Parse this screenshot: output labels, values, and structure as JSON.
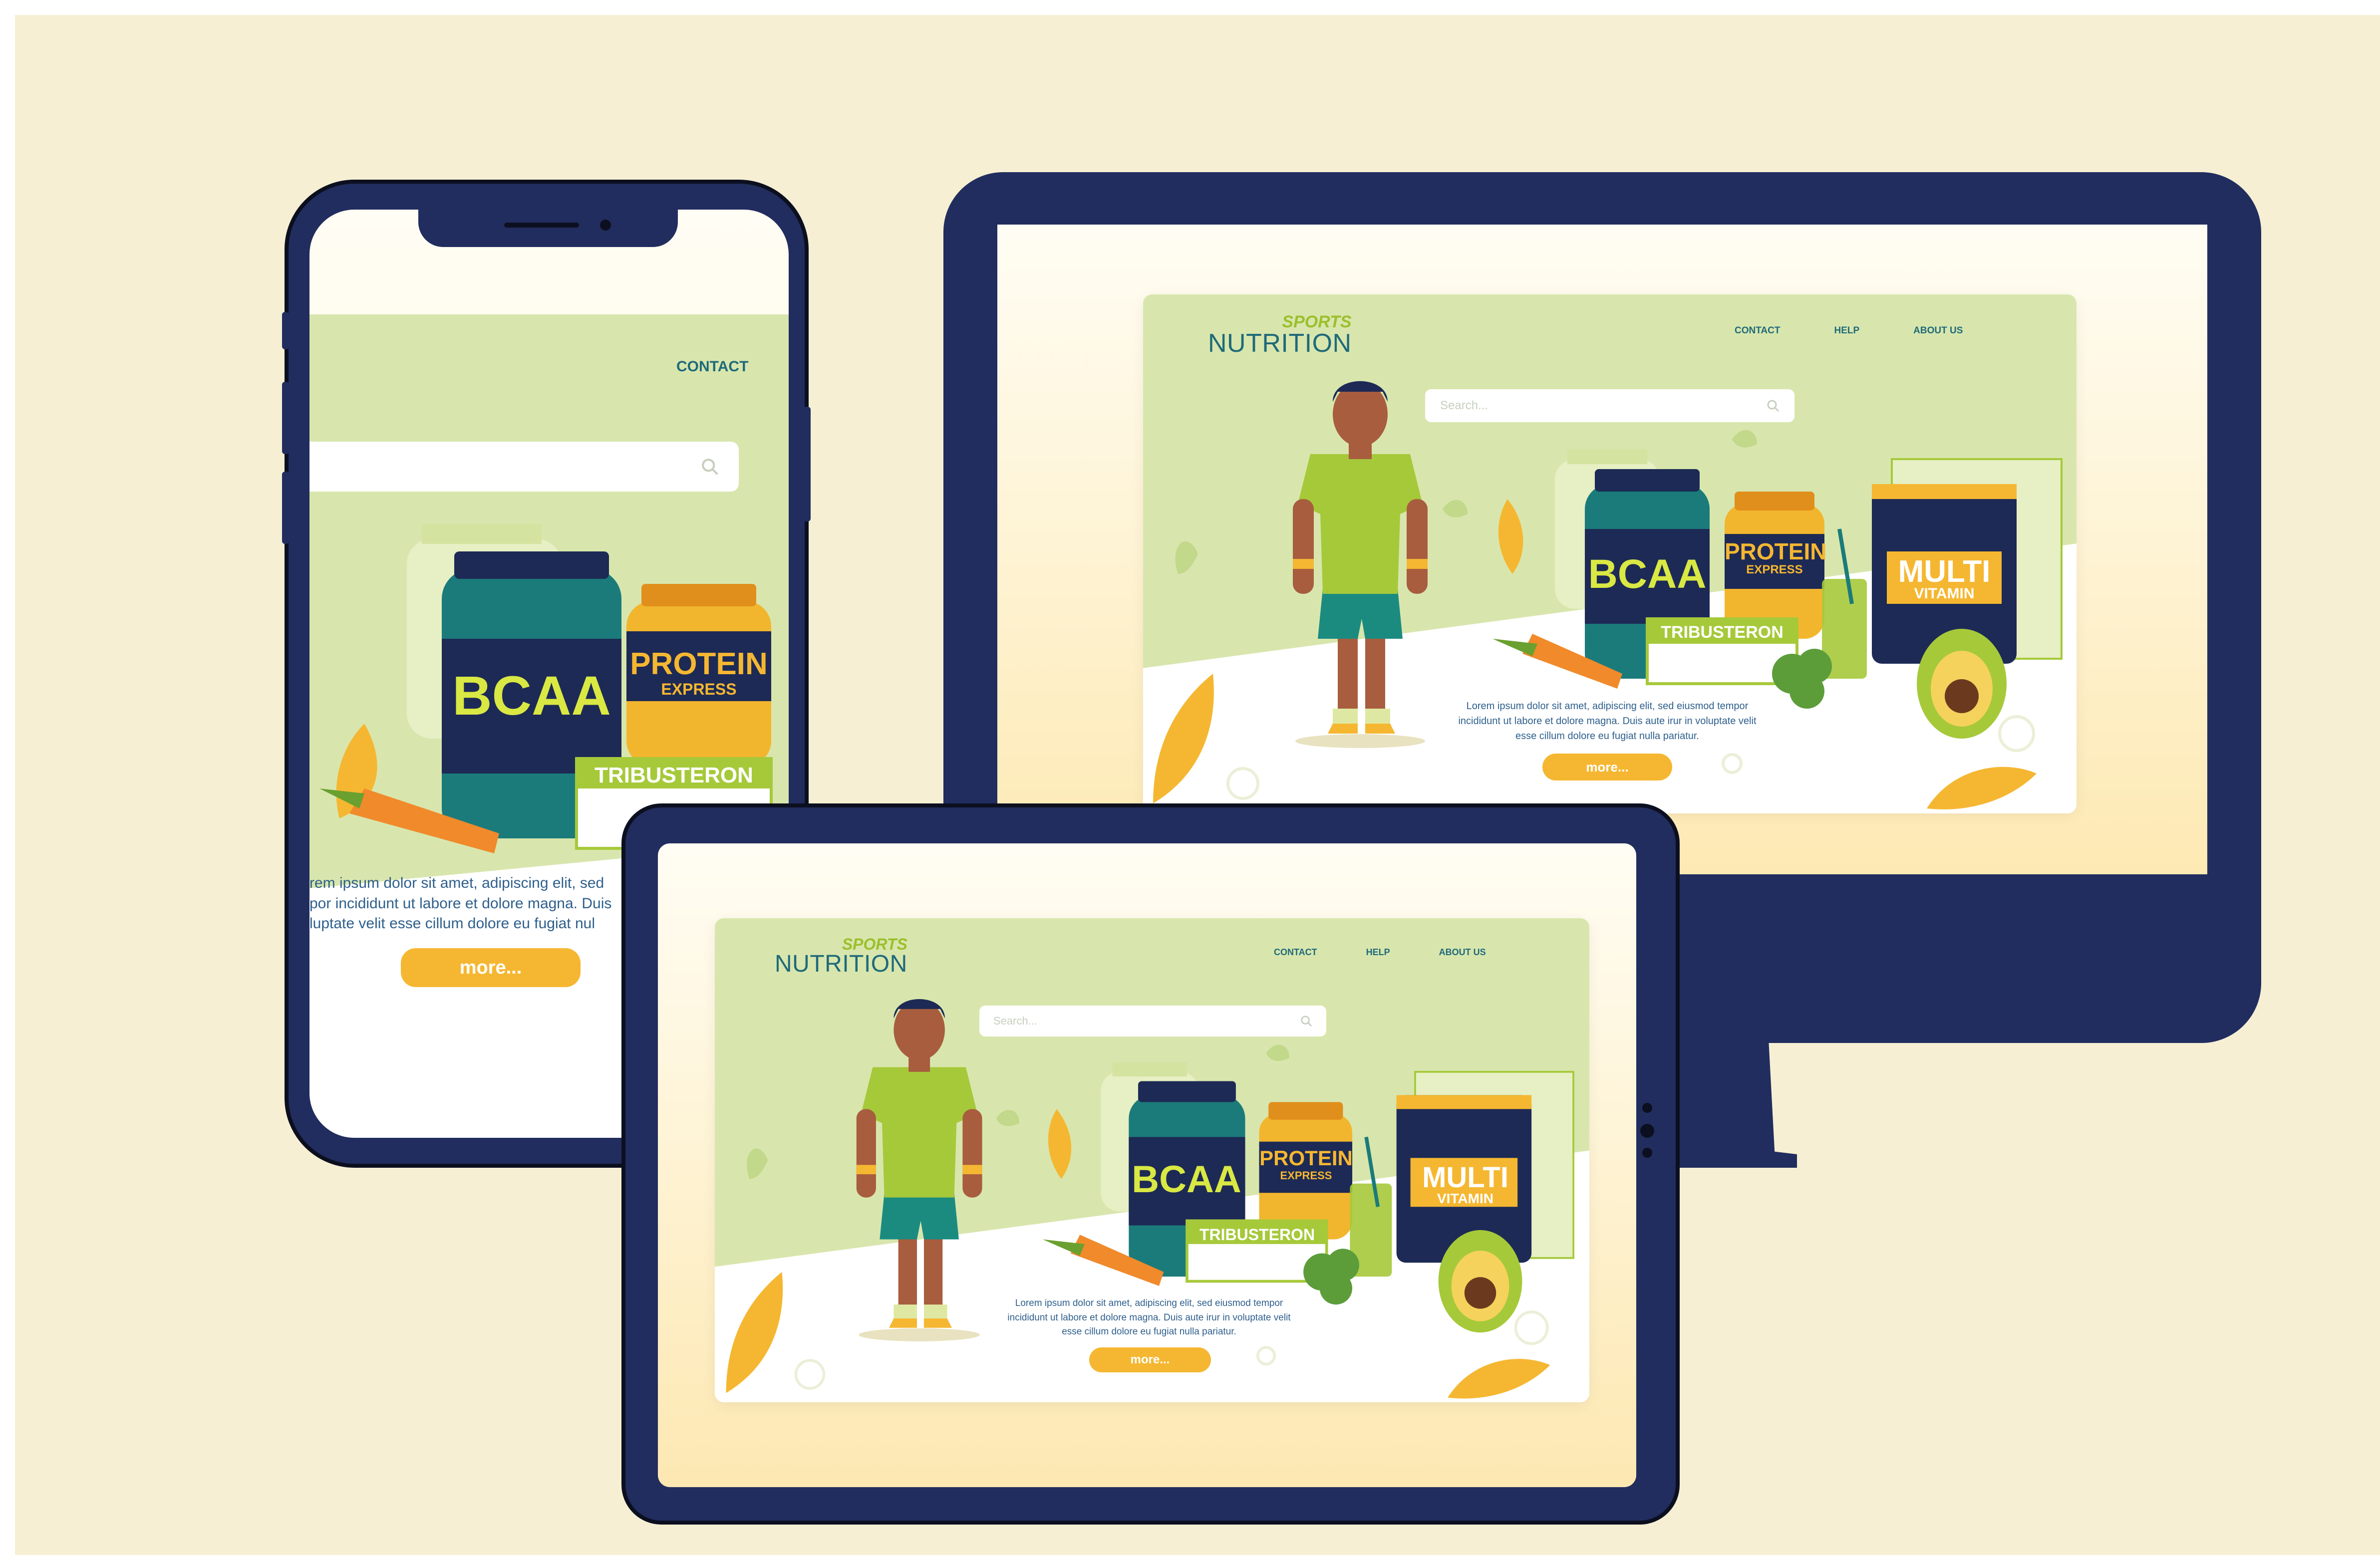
{
  "colors": {
    "background": "#f6efd3",
    "device_frame": "#212d5e",
    "hero_green": "#d8e6ad",
    "accent_orange": "#f5b731",
    "brand_green": "#9cbf2d",
    "brand_teal": "#1f6a7a"
  },
  "site": {
    "brand_top": "SPORTS",
    "brand_bottom": "NUTRITION",
    "nav": [
      "CONTACT",
      "HELP",
      "ABOUT US"
    ],
    "search_placeholder": "Search...",
    "body_text": "Lorem ipsum dolor sit amet, adipiscing elit, sed eiusmod tempor incididunt ut labore et dolore magna. Duis aute irur in voluptate velit esse cillum dolore eu fugiat nulla pariatur.",
    "more_button": "more..."
  },
  "products": {
    "bcaa": "BCAA",
    "protein": "PROTEIN",
    "protein_sub": "EXPRESS",
    "tribusteron": "TRIBUSTERON",
    "multi": "MULTI",
    "vitamin": "VITAMIN"
  },
  "phone": {
    "nav_contact": "CONTACT",
    "body_lines": [
      "rem ipsum dolor sit amet, adipiscing elit, sed",
      "por incididunt ut labore et dolore magna. Duis",
      "luptate velit esse cillum dolore eu fugiat nul"
    ]
  },
  "icons": [
    "search-icon",
    "leaf-icon",
    "carrot-icon",
    "avocado-icon",
    "broccoli-icon"
  ]
}
